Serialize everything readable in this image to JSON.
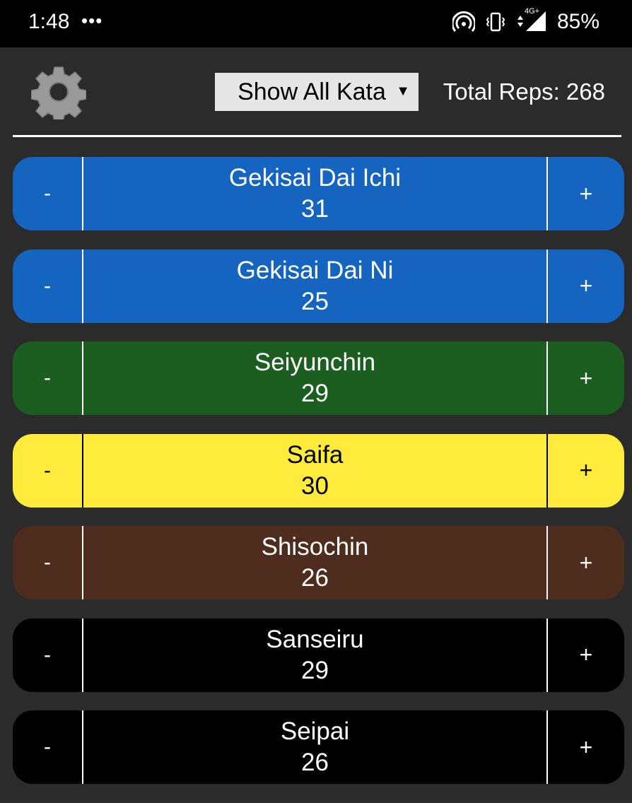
{
  "status_bar": {
    "time": "1:48",
    "dots": "•••",
    "battery": "85%",
    "network_label": "4G+"
  },
  "header": {
    "filter_label": "Show All Kata",
    "total_reps": "Total Reps: 268"
  },
  "kata": [
    {
      "name": "Gekisai Dai Ichi",
      "count": "31",
      "bg": "#1565c0",
      "fg": "#ffffff",
      "minus": "-",
      "plus": "+"
    },
    {
      "name": "Gekisai Dai Ni",
      "count": "25",
      "bg": "#1565c0",
      "fg": "#ffffff",
      "minus": "-",
      "plus": "+"
    },
    {
      "name": "Seiyunchin",
      "count": "29",
      "bg": "#1b5e20",
      "fg": "#ffffff",
      "minus": "-",
      "plus": "+"
    },
    {
      "name": "Saifa",
      "count": "30",
      "bg": "#ffeb3b",
      "fg": "#000000",
      "minus": "-",
      "plus": "+"
    },
    {
      "name": "Shisochin",
      "count": "26",
      "bg": "#4e2c1e",
      "fg": "#ffffff",
      "minus": "-",
      "plus": "+"
    },
    {
      "name": "Sanseiru",
      "count": "29",
      "bg": "#000000",
      "fg": "#ffffff",
      "minus": "-",
      "plus": "+"
    },
    {
      "name": "Seipai",
      "count": "26",
      "bg": "#000000",
      "fg": "#ffffff",
      "minus": "-",
      "plus": "+"
    }
  ]
}
